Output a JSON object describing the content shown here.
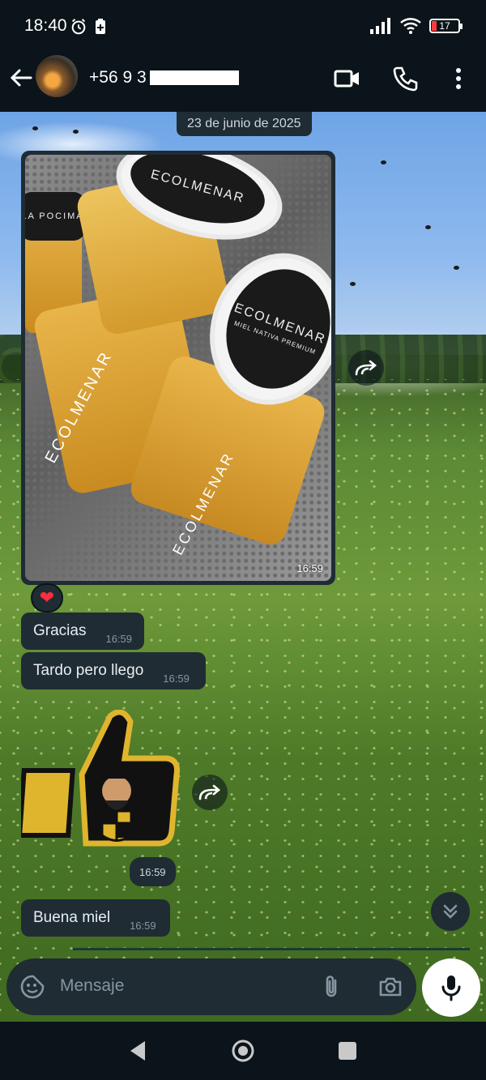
{
  "status_bar": {
    "time": "18:40",
    "battery_level": "17",
    "battery_color": "#ff3b3b"
  },
  "header": {
    "contact_name_visible": "+56 9 3"
  },
  "chat": {
    "date_chip": "23 de junio de 2025",
    "image_message": {
      "time": "16:59",
      "jar_brand": "ECOLMENAR",
      "jar_subtitle": "MIEL NATIVA PREMIUM",
      "small_jar_label": "LA POCIMA"
    },
    "reaction_emoji": "❤",
    "messages": [
      {
        "text": "Gracias",
        "time": "16:59"
      },
      {
        "text": "Tardo pero llego",
        "time": "16:59"
      }
    ],
    "sticker": {
      "time": "16:59"
    },
    "last_message": {
      "text": "Buena miel",
      "time": "16:59"
    }
  },
  "input": {
    "placeholder": "Mensaje"
  },
  "colors": {
    "bubble": "#1f2c34",
    "app_bg": "#0b141a",
    "accent": "#e0b52e"
  }
}
